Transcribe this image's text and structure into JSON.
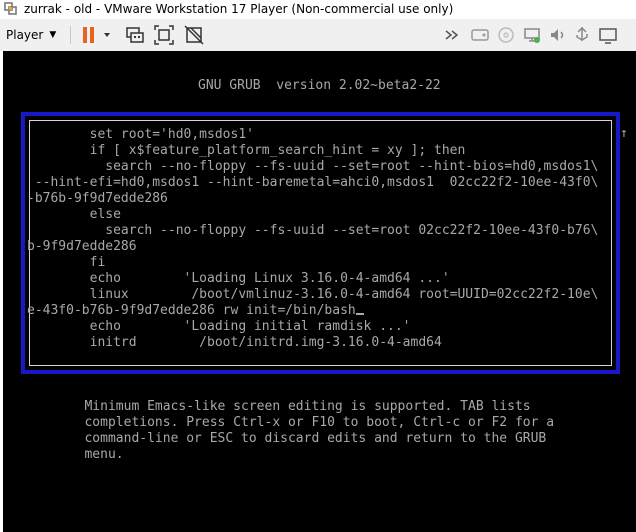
{
  "window": {
    "title": "zurrak - old - VMware Workstation 17 Player (Non-commercial use only)",
    "app_icon": "vmware-icon"
  },
  "toolbar": {
    "player_label": "Player",
    "buttons": [
      {
        "name": "pause-icon"
      },
      {
        "name": "send-ctrl-alt-del-icon"
      },
      {
        "name": "fit-guest-icon"
      },
      {
        "name": "unity-icon"
      },
      {
        "name": "forward-icon"
      },
      {
        "name": "removable-device-icon"
      },
      {
        "name": "cd-dvd-icon"
      },
      {
        "name": "network-icon"
      },
      {
        "name": "sound-icon"
      },
      {
        "name": "usb-icon"
      },
      {
        "name": "display-icon"
      }
    ]
  },
  "grub": {
    "header": "GNU GRUB  version 2.02~beta2-22",
    "lines": [
      "        set root='hd0,msdos1'",
      "        if [ x$feature_platform_search_hint = xy ]; then",
      "          search --no-floppy --fs-uuid --set=root --hint-bios=hd0,msdos1\\",
      " --hint-efi=hd0,msdos1 --hint-baremetal=ahci0,msdos1  02cc22f2-10ee-43f0\\",
      "-b76b-9f9d7edde286",
      "        else",
      "          search --no-floppy --fs-uuid --set=root 02cc22f2-10ee-43f0-b76\\",
      "b-9f9d7edde286",
      "        fi",
      "        echo        'Loading Linux 3.16.0-4-amd64 ...'",
      "        linux        /boot/vmlinuz-3.16.0-4-amd64 root=UUID=02cc22f2-10e\\",
      "e-43f0-b76b-9f9d7edde286 rw init=/bin/bash",
      "        echo        'Loading initial ramdisk ...'",
      "        initrd        /boot/initrd.img-3.16.0-4-amd64"
    ],
    "scroll_indicator": "↑",
    "help_lines": [
      "   Minimum Emacs-like screen editing is supported. TAB lists",
      "   completions. Press Ctrl-x or F10 to boot, Ctrl-c or F2 for a",
      "   command-line or ESC to discard edits and return to the GRUB",
      "   menu."
    ]
  },
  "colors": {
    "console_bg": "#000000",
    "console_text": "#a8a8a8",
    "frame_blue": "#1818c8",
    "pause_orange": "#e8641e"
  }
}
